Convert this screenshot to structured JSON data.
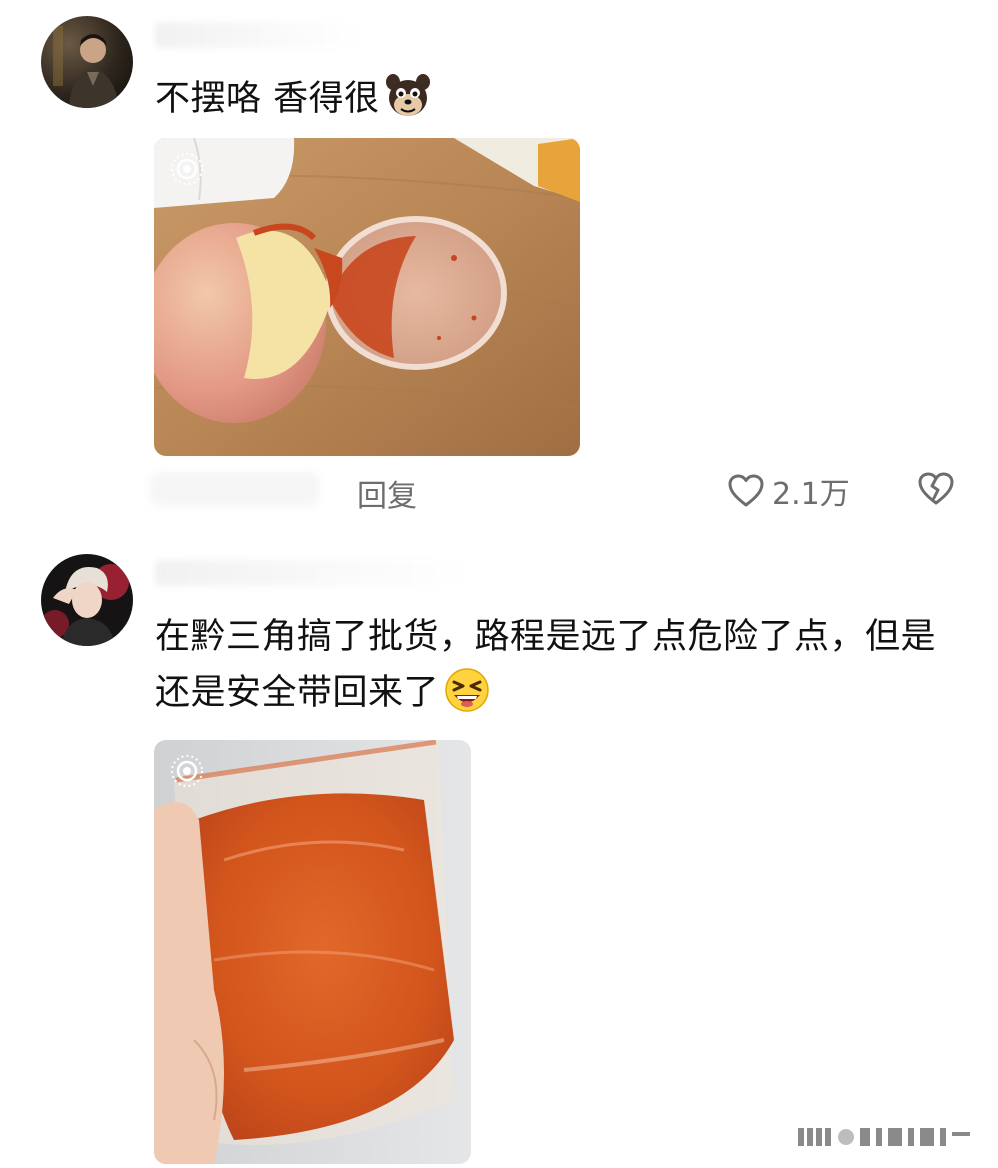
{
  "comments": [
    {
      "text": "不摆咯 香得很",
      "emoji": "dog-face-emoji",
      "photo": "apple-with-chili-powder-photo",
      "reply_label": "回复",
      "like_count": "2.1万"
    },
    {
      "text": "在黔三角搞了批货，路程是远了点危险了点，但是还是安全带回来了",
      "emoji": "grinning-squint-face-emoji",
      "photo": "bag-of-chili-powder-photo"
    }
  ],
  "icons": {
    "like": "heart-outline-icon",
    "dislike": "broken-heart-icon",
    "live_photo": "live-photo-icon"
  },
  "colors": {
    "text": "#111111",
    "muted": "#6d6d6d",
    "chili": "#d2551c"
  }
}
